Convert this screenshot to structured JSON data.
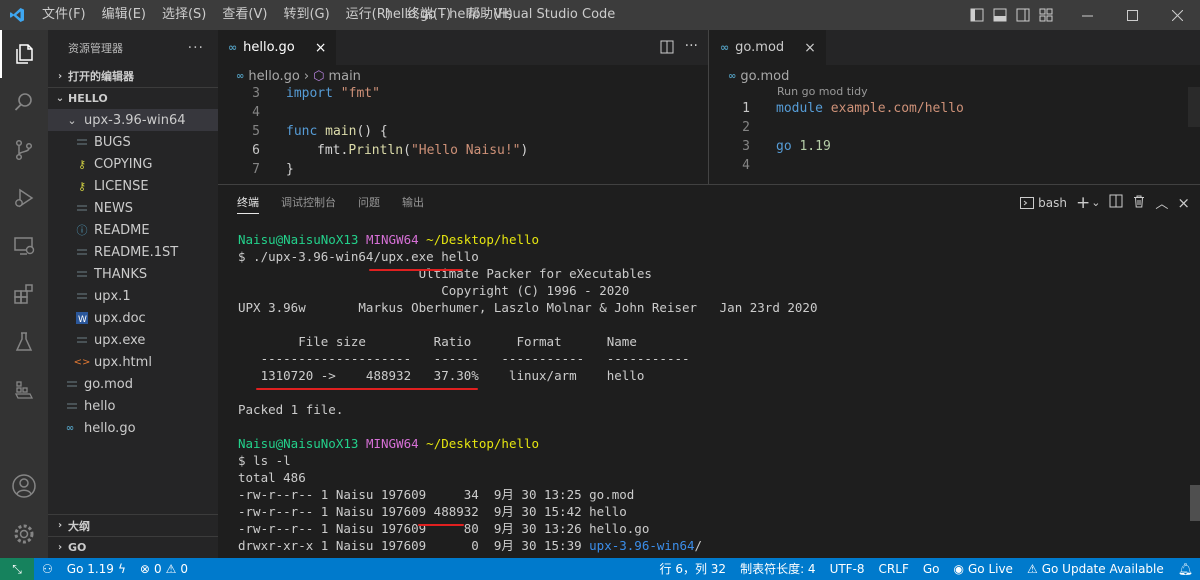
{
  "titlebar": {
    "menu": [
      "文件(F)",
      "编辑(E)",
      "选择(S)",
      "查看(V)",
      "转到(G)",
      "运行(R)",
      "终端(T)",
      "帮助(H)"
    ],
    "title": "hello.go - hello - Visual Studio Code"
  },
  "sidebar": {
    "header": "资源管理器",
    "open_editors": "打开的编辑器",
    "root": "HELLO",
    "folder": "upx-3.96-win64",
    "files": [
      "BUGS",
      "COPYING",
      "LICENSE",
      "NEWS",
      "README",
      "README.1ST",
      "THANKS",
      "upx.1",
      "upx.doc",
      "upx.exe",
      "upx.html"
    ],
    "root_files": [
      "go.mod",
      "hello",
      "hello.go"
    ],
    "outline": "大纲",
    "go": "GO"
  },
  "editor_left": {
    "tab": "hello.go",
    "crumb_file": "hello.go",
    "crumb_symbol": "main",
    "lines": [
      {
        "n": "3",
        "kw": "import",
        "rest": " \"fmt\""
      },
      {
        "n": "4"
      },
      {
        "n": "5",
        "kw": "func",
        "fn": " main",
        "rest": "() {"
      },
      {
        "n": "6",
        "call": "fmt.",
        "fn": "Println",
        "str": "\"Hello Naisu!\"",
        "close": ")"
      },
      {
        "n": "7",
        "rest": "}"
      }
    ]
  },
  "editor_right": {
    "tab": "go.mod",
    "crumb_file": "go.mod",
    "codelens": "Run go mod tidy",
    "lines": [
      {
        "n": "1",
        "kw": "module",
        "rest": " example.com/hello"
      },
      {
        "n": "2"
      },
      {
        "n": "3",
        "kw": "go",
        "rest": " 1.19"
      },
      {
        "n": "4"
      }
    ]
  },
  "panel": {
    "tabs": [
      "终端",
      "调试控制台",
      "问题",
      "输出"
    ],
    "shell": "bash"
  },
  "terminal": {
    "prompt_user": "Naisu@NaisuNoX13",
    "prompt_env": "MINGW64",
    "prompt_path": "~/Desktop/hello",
    "cmd1": "$ ./upx-3.96-win64/upx.exe hello",
    "out1": [
      "                        Ultimate Packer for eXecutables",
      "                           Copyright (C) 1996 - 2020",
      "UPX 3.96w       Markus Oberhumer, Laszlo Molnar & John Reiser   Jan 23rd 2020",
      "",
      "        File size         Ratio      Format      Name",
      "   --------------------   ------   -----------   -----------",
      "   1310720 ->    488932   37.30%    linux/arm    hello",
      "",
      "Packed 1 file.",
      ""
    ],
    "cmd2": "$ ls -l",
    "ls": [
      "total 486",
      "-rw-r--r-- 1 Naisu 197609     34  9月 30 13:25 go.mod",
      "-rw-r--r-- 1 Naisu 197609 488932  9月 30 15:42 hello",
      "-rw-r--r-- 1 Naisu 197609     80  9月 30 13:26 hello.go"
    ],
    "ls_dir_prefix": "drwxr-xr-x 1 Naisu 197609      0  9月 30 15:39 ",
    "ls_dir_name": "upx-3.96-win64",
    "ls_dir_suffix": "/"
  },
  "statusbar": {
    "go_version": "Go 1.19",
    "problems": "0",
    "warnings": "0",
    "position": "行 6，列 32",
    "tab_size": "制表符长度: 4",
    "encoding": "UTF-8",
    "eol": "CRLF",
    "language": "Go",
    "go_live": "Go Live",
    "go_update": "Go Update Available"
  },
  "colors": {
    "accent": "#007acc",
    "terminal_user": "#23d18b",
    "terminal_env": "#d670d6",
    "terminal_path": "#e5e510",
    "annotation": "#e02020"
  }
}
